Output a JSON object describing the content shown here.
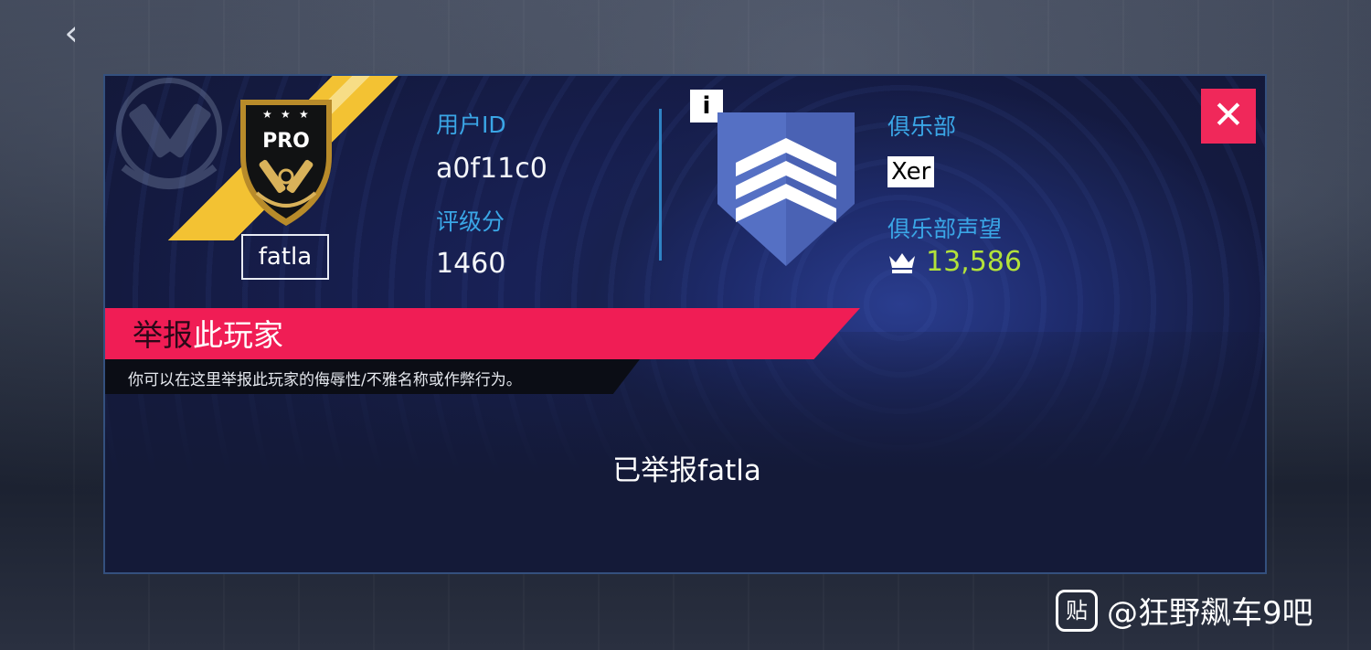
{
  "player": {
    "username": "fatla",
    "badge_text": "PRO",
    "user_id_label": "用户ID",
    "user_id": "a0f11c0",
    "rating_label": "评级分",
    "rating": "1460"
  },
  "club": {
    "info_label": "i",
    "club_label": "俱乐部",
    "club_name": "Xer",
    "fame_label": "俱乐部声望",
    "fame_value": "13,586"
  },
  "report": {
    "title_part1": "举报",
    "title_part2": "此玩家",
    "description": "你可以在这里举报此玩家的侮辱性/不雅名称或作弊行为。",
    "status": "已举报fatla"
  },
  "controls": {
    "close_glyph": "✕",
    "back_glyph": "‹"
  },
  "watermark": {
    "box_text": "贴",
    "text": "@狂野飙车9吧"
  },
  "colors": {
    "accent_red": "#f01d55",
    "label_cyan": "#3aa6e6",
    "fame_green": "#b3e23a",
    "badge_gold": "#f3c233"
  }
}
